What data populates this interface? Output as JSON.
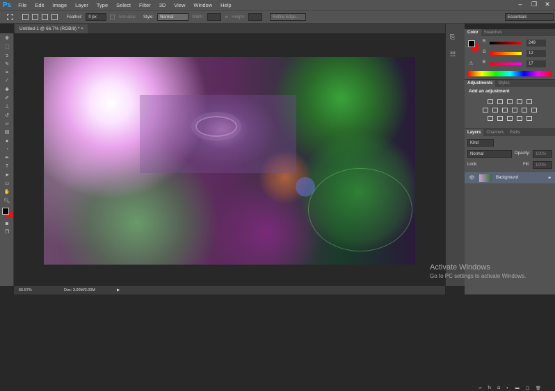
{
  "app": {
    "logo": "Ps",
    "window_controls": [
      "–",
      "❐",
      "✕"
    ]
  },
  "menu": [
    "File",
    "Edit",
    "Image",
    "Layer",
    "Type",
    "Select",
    "Filter",
    "3D",
    "View",
    "Window",
    "Help"
  ],
  "options": {
    "feather_label": "Feather:",
    "feather_value": "0 px",
    "antialias_label": "Anti-alias",
    "style_label": "Style:",
    "style_value": "Normal",
    "width_label": "Width:",
    "height_label": "Height:",
    "refine_edge": "Refine Edge...",
    "workspace": "Essentials"
  },
  "document": {
    "tab_title": "Untitled-1 @ 66.7% (RGB/8) *",
    "close": "×"
  },
  "status": {
    "zoom": "66.67%",
    "doc": "Doc: 3.00M/3.00M"
  },
  "color_panel": {
    "tabs": [
      "Color",
      "Swatches"
    ],
    "r_label": "R",
    "g_label": "G",
    "b_label": "B",
    "r": "249",
    "g": "12",
    "b": "17",
    "fg_color": "#000000",
    "bg_color": "#f90c11"
  },
  "adjustments": {
    "tabs": [
      "Adjustments",
      "Styles"
    ],
    "heading": "Add an adjustment"
  },
  "layers": {
    "tabs": [
      "Layers",
      "Channels",
      "Paths"
    ],
    "kind": "Kind",
    "blend": "Normal",
    "opacity_label": "Opacity:",
    "opacity": "100%",
    "lock_label": "Lock:",
    "fill_label": "Fill:",
    "fill": "100%",
    "layer_name": "Background"
  },
  "watermark": {
    "title": "Activate Windows",
    "subtitle": "Go to PC settings to activate Windows."
  }
}
